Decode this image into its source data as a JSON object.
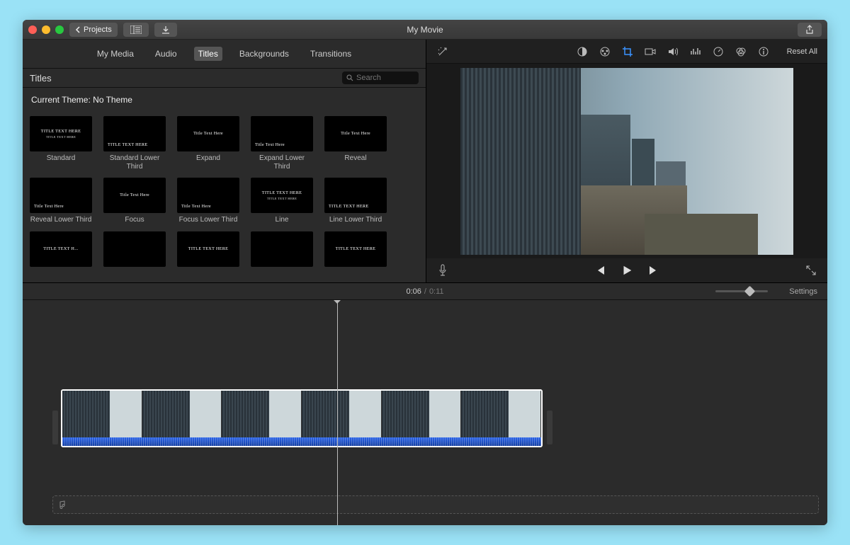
{
  "window": {
    "title": "My Movie"
  },
  "toolbar": {
    "back_label": "Projects",
    "share_tooltip": "Share"
  },
  "tabs": {
    "items": [
      "My Media",
      "Audio",
      "Titles",
      "Backgrounds",
      "Transitions"
    ],
    "active_index": 2
  },
  "browser": {
    "header": "Titles",
    "search_placeholder": "Search",
    "theme_label": "Current Theme: No Theme",
    "titles_row1": [
      {
        "label": "Standard",
        "thumb": "TITLE TEXT HERE"
      },
      {
        "label": "Standard Lower Third",
        "thumb": "TITLE TEXT HERE",
        "lower": true
      },
      {
        "label": "Expand",
        "thumb": "Title Text Here"
      },
      {
        "label": "Expand Lower Third",
        "thumb": "Title Text Here",
        "lower": true
      },
      {
        "label": "Reveal",
        "thumb": "Title Text Here"
      }
    ],
    "titles_row2": [
      {
        "label": "Reveal Lower Third",
        "thumb": "Title Text Here",
        "lower": true
      },
      {
        "label": "Focus",
        "thumb": "Title Text Here"
      },
      {
        "label": "Focus Lower Third",
        "thumb": "Title Text Here",
        "lower": true
      },
      {
        "label": "Line",
        "thumb": "TITLE TEXT HERE"
      },
      {
        "label": "Line Lower Third",
        "thumb": "TITLE TEXT HERE",
        "lower": true
      }
    ],
    "titles_row3": [
      {
        "label": "",
        "thumb": "TITLE TEXT H..."
      },
      {
        "label": "",
        "thumb": "",
        "lower": true
      },
      {
        "label": "",
        "thumb": "TITLE TEXT HERE"
      },
      {
        "label": "",
        "thumb": "",
        "lower": true
      },
      {
        "label": "",
        "thumb": "TITLE TEXT HERE"
      }
    ]
  },
  "adjust": {
    "reset_label": "Reset All",
    "icons": [
      "magic-wand",
      "color-balance",
      "color-wheel",
      "crop",
      "camera",
      "volume",
      "equalizer",
      "speed",
      "filters",
      "info"
    ],
    "active_icon": "crop"
  },
  "transport": {
    "mic": "mic-icon",
    "prev": "skip-back-icon",
    "play": "play-icon",
    "next": "skip-forward-icon",
    "full": "expand-icon"
  },
  "timecode": {
    "current": "0:06",
    "total": "0:11"
  },
  "timeline": {
    "settings_label": "Settings"
  }
}
